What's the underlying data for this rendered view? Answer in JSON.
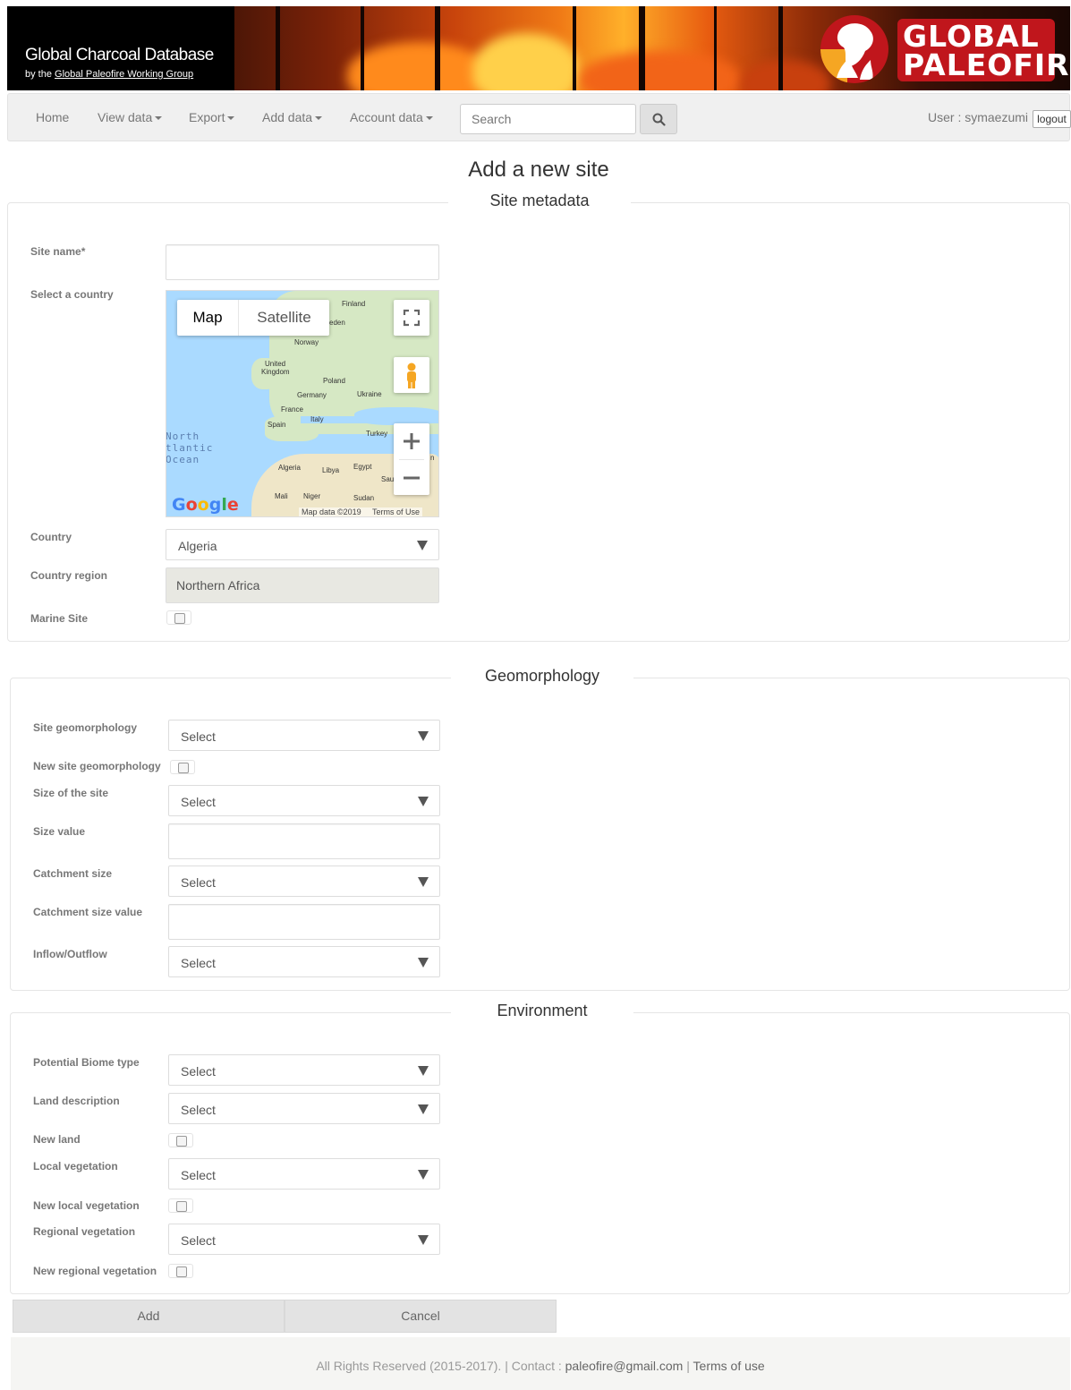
{
  "banner": {
    "title": "Global Charcoal Database",
    "subtitle_prefix": "by the",
    "subtitle_link": "Global Paleofire Working Group",
    "logo_line1": "GLOBAL",
    "logo_line2": "PALEOFIRE",
    "brand_color": "#c0161c"
  },
  "nav": {
    "home": "Home",
    "view_data": "View data",
    "export": "Export",
    "add_data": "Add data",
    "account_data": "Account data",
    "search_placeholder": "Search",
    "user_label": "User : symaezumi",
    "logout": "logout"
  },
  "page": {
    "title": "Add a new site"
  },
  "site_metadata": {
    "legend": "Site metadata",
    "site_name_label": "Site name*",
    "site_name_value": "",
    "select_country_label": "Select a country",
    "country_label": "Country",
    "country_value": "Algeria",
    "country_region_label": "Country region",
    "country_region_value": "Northern Africa",
    "marine_site_label": "Marine Site"
  },
  "map": {
    "btn_map": "Map",
    "btn_satellite": "Satellite",
    "google": "Google",
    "credit": "Map data ©2019",
    "terms": "Terms of Use",
    "labels": {
      "finland": "Finland",
      "sweden": "eden",
      "norway": "Norway",
      "uk1": "United",
      "uk2": "Kingdom",
      "poland": "Poland",
      "germany": "Germany",
      "ukraine": "Ukraine",
      "france": "France",
      "italy": "Italy",
      "spain": "Spain",
      "turkey": "Turkey",
      "algeria": "Algeria",
      "libya": "Libya",
      "egypt": "Egypt",
      "mali": "Mali",
      "niger": "Niger",
      "sudan": "Sudan",
      "saudi": "Sau",
      "iran": "n",
      "ocean1": "North",
      "ocean2": "tlantic",
      "ocean3": "Ocean"
    }
  },
  "geomorphology": {
    "legend": "Geomorphology",
    "site_geomorphology_label": "Site geomorphology",
    "site_geomorphology_value": "Select",
    "new_site_geomorphology_label": "New site geomorphology",
    "size_of_site_label": "Size of the site",
    "size_of_site_value": "Select",
    "size_value_label": "Size value",
    "size_value_value": "",
    "catchment_size_label": "Catchment size",
    "catchment_size_value": "Select",
    "catchment_size_value_label": "Catchment size value",
    "catchment_size_value_value": "",
    "inflow_outflow_label": "Inflow/Outflow",
    "inflow_outflow_value": "Select"
  },
  "environment": {
    "legend": "Environment",
    "biome_label": "Potential Biome type",
    "biome_value": "Select",
    "land_description_label": "Land description",
    "land_description_value": "Select",
    "new_land_label": "New land",
    "local_vegetation_label": "Local vegetation",
    "local_vegetation_value": "Select",
    "new_local_vegetation_label": "New local vegetation",
    "regional_vegetation_label": "Regional vegetation",
    "regional_vegetation_value": "Select",
    "new_regional_vegetation_label": "New regional vegetation"
  },
  "actions": {
    "add": "Add",
    "cancel": "Cancel"
  },
  "footer": {
    "rights": "All Rights Reserved (2015-2017). | Contact :",
    "email": "paleofire@gmail.com",
    "separator": "|",
    "terms": "Terms of use"
  }
}
